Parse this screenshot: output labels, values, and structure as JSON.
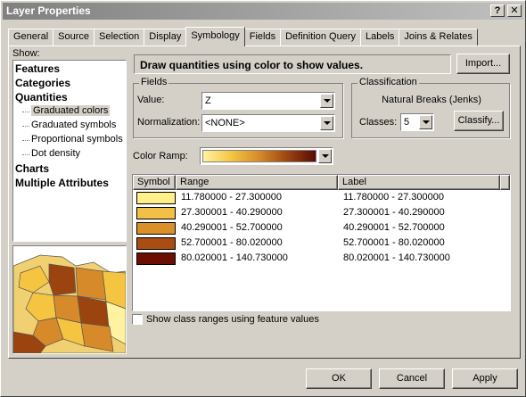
{
  "window": {
    "title": "Layer Properties",
    "help_label": "?",
    "close_label": "✕"
  },
  "tabs": [
    {
      "label": "General"
    },
    {
      "label": "Source"
    },
    {
      "label": "Selection"
    },
    {
      "label": "Display"
    },
    {
      "label": "Symbology",
      "active": true
    },
    {
      "label": "Fields"
    },
    {
      "label": "Definition Query"
    },
    {
      "label": "Labels"
    },
    {
      "label": "Joins & Relates"
    }
  ],
  "show": {
    "label": "Show:",
    "items": [
      {
        "label": "Features",
        "level": 0
      },
      {
        "label": "Categories",
        "level": 0
      },
      {
        "label": "Quantities",
        "level": 0
      },
      {
        "label": "Graduated colors",
        "level": 1,
        "selected": true
      },
      {
        "label": "Graduated symbols",
        "level": 1
      },
      {
        "label": "Proportional symbols",
        "level": 1
      },
      {
        "label": "Dot density",
        "level": 1
      },
      {
        "label": "Charts",
        "level": 0
      },
      {
        "label": "Multiple Attributes",
        "level": 0
      }
    ]
  },
  "header": {
    "description": "Draw quantities using color to show values.",
    "import_label": "Import..."
  },
  "fields": {
    "legend": "Fields",
    "value_label": "Value:",
    "value": "Z",
    "normalization_label": "Normalization:",
    "normalization": "<NONE>"
  },
  "classification": {
    "legend": "Classification",
    "method": "Natural Breaks (Jenks)",
    "classes_label": "Classes:",
    "classes": "5",
    "classify_label": "Classify..."
  },
  "color_ramp": {
    "label": "Color Ramp:",
    "colors": [
      "#fff2a0",
      "#f5c542",
      "#d68a2a",
      "#9c4410",
      "#5a0a05"
    ]
  },
  "table": {
    "columns": [
      "Symbol",
      "Range",
      "Label"
    ],
    "rows": [
      {
        "color": "#fff089",
        "range": "11.780000 - 27.300000",
        "label": "11.780000 - 27.300000"
      },
      {
        "color": "#f2c046",
        "range": "27.300001 - 40.290000",
        "label": "27.300001 - 40.290000"
      },
      {
        "color": "#d9902a",
        "range": "40.290001 - 52.700000",
        "label": "40.290001 - 52.700000"
      },
      {
        "color": "#a94d12",
        "range": "52.700001 - 80.020000",
        "label": "52.700001 - 80.020000"
      },
      {
        "color": "#6b0f05",
        "range": "80.020001 - 140.730000",
        "label": "80.020001 - 140.730000"
      }
    ]
  },
  "feature_checkbox": {
    "label": "Show class ranges using feature values",
    "checked": false
  },
  "footer": {
    "ok_label": "OK",
    "cancel_label": "Cancel",
    "apply_label": "Apply"
  }
}
